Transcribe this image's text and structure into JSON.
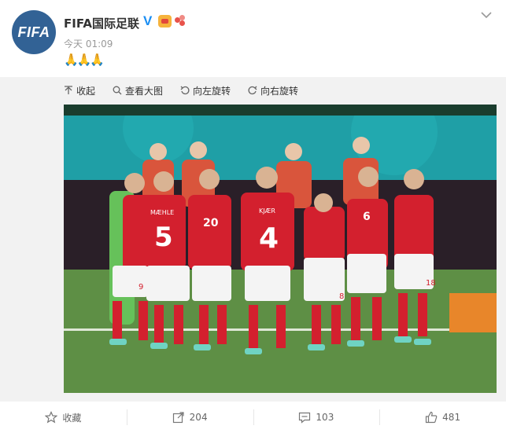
{
  "post": {
    "avatar_text": "FIFA",
    "username": "FIFA国际足联",
    "verified_glyph": "V",
    "timestamp": "今天 01:09",
    "content_emoji": "🙏🙏🙏",
    "icons": {
      "menu": "chevron-down-icon",
      "badges": [
        "vip-badge-icon",
        "fan-badge-icon"
      ]
    },
    "colors": {
      "avatar_bg": "#326295",
      "verified": "#1b8ef3",
      "link_text": "#333333"
    }
  },
  "media_toolbar": {
    "collapse_label": "收起",
    "view_large_label": "查看大图",
    "rotate_left_label": "向左旋转",
    "rotate_right_label": "向右旋转"
  },
  "photo": {
    "jersey_numbers": [
      "9",
      "5",
      "20",
      "4",
      "6",
      "18",
      "8"
    ],
    "jersey_names": [
      "MÆHLE",
      "KJÆR"
    ],
    "description_alt": "Denmark players forming a circle on the pitch"
  },
  "footer": {
    "favorite_label": "收藏",
    "repost_count": "204",
    "comment_count": "103",
    "like_count": "481"
  }
}
